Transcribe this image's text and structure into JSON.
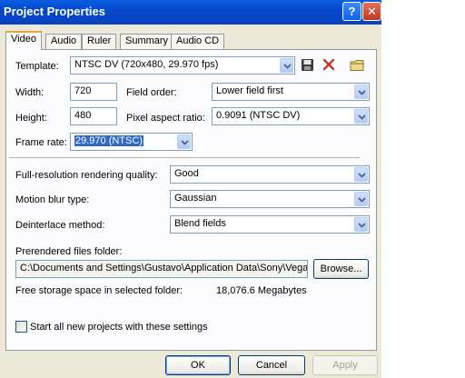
{
  "window": {
    "title": "Project Properties",
    "help_glyph": "?",
    "close_glyph": "✕"
  },
  "tabs": [
    {
      "label": "Video"
    },
    {
      "label": "Audio"
    },
    {
      "label": "Ruler"
    },
    {
      "label": "Summary"
    },
    {
      "label": "Audio CD"
    }
  ],
  "video": {
    "template_label": "Template:",
    "template_value": "NTSC DV (720x480, 29.970 fps)",
    "width_label": "Width:",
    "width_value": "720",
    "height_label": "Height:",
    "height_value": "480",
    "field_order_label": "Field order:",
    "field_order_value": "Lower field first",
    "pixel_aspect_label": "Pixel aspect ratio:",
    "pixel_aspect_value": "0.9091 (NTSC DV)",
    "frame_rate_label": "Frame rate:",
    "frame_rate_value": "29.970 (NTSC)",
    "render_quality_label": "Full-resolution rendering quality:",
    "render_quality_value": "Good",
    "motion_blur_label": "Motion blur type:",
    "motion_blur_value": "Gaussian",
    "deinterlace_label": "Deinterlace method:",
    "deinterlace_value": "Blend fields",
    "prerender_label": "Prerendered files folder:",
    "prerender_path": "C:\\Documents and Settings\\Gustavo\\Application Data\\Sony\\Vegas",
    "browse_label": "Browse...",
    "free_space_label": "Free storage space in selected folder:",
    "free_space_value": "18,076.6 Megabytes",
    "start_all_label": "Start all new projects with these settings",
    "start_all_checked": false
  },
  "footer": {
    "ok_label": "OK",
    "cancel_label": "Cancel",
    "apply_label": "Apply"
  },
  "icons": [
    "save-icon",
    "delete-icon",
    "folder-icon",
    "chevron-down-icon"
  ],
  "colors": {
    "titlebar": "#0a5fe2",
    "dialog_bg": "#ece9d8",
    "selection": "#316ac5",
    "delete_red": "#c0392b"
  }
}
